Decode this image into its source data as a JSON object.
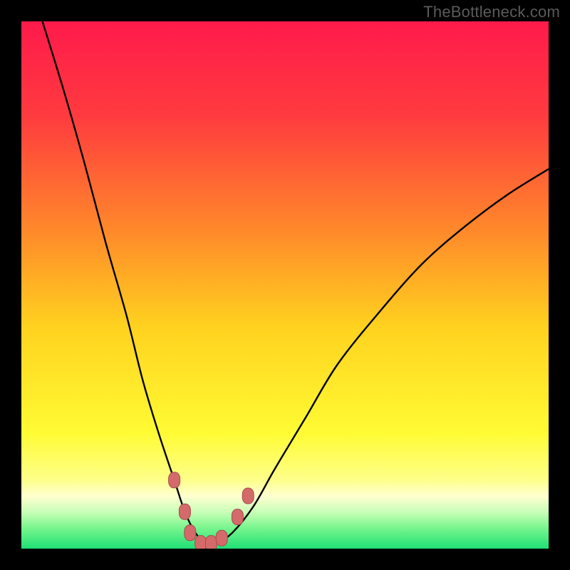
{
  "watermark": "TheBottleneck.com",
  "colors": {
    "bg_black": "#000000",
    "gradient_stops": [
      {
        "offset": 0.0,
        "color": "#ff1a4b"
      },
      {
        "offset": 0.18,
        "color": "#ff3b3f"
      },
      {
        "offset": 0.4,
        "color": "#ff8a2a"
      },
      {
        "offset": 0.58,
        "color": "#ffd21f"
      },
      {
        "offset": 0.78,
        "color": "#fffb33"
      },
      {
        "offset": 0.87,
        "color": "#fdff8a"
      },
      {
        "offset": 0.9,
        "color": "#ffffd0"
      },
      {
        "offset": 0.93,
        "color": "#caffb8"
      },
      {
        "offset": 0.96,
        "color": "#7af58e"
      },
      {
        "offset": 1.0,
        "color": "#1fe076"
      }
    ],
    "curve": "#000000",
    "marker_fill": "#d46a6a",
    "marker_stroke": "#a34c4c"
  },
  "chart_data": {
    "type": "line",
    "title": "",
    "xlabel": "",
    "ylabel": "",
    "xlim": [
      0,
      100
    ],
    "ylim": [
      0,
      100
    ],
    "series": [
      {
        "name": "bottleneck-curve",
        "x": [
          4,
          8,
          12,
          16,
          20,
          23,
          26,
          29,
          31,
          33,
          35,
          37,
          40,
          44,
          48,
          54,
          60,
          68,
          76,
          84,
          92,
          100
        ],
        "y": [
          100,
          87,
          73,
          58,
          44,
          32,
          22,
          13,
          7,
          3,
          1,
          1,
          3,
          8,
          15,
          25,
          35,
          45,
          54,
          61,
          67,
          72
        ]
      }
    ],
    "markers": {
      "name": "highlight-cluster",
      "points": [
        {
          "x": 29,
          "y": 13
        },
        {
          "x": 31,
          "y": 7
        },
        {
          "x": 32,
          "y": 3
        },
        {
          "x": 34,
          "y": 1
        },
        {
          "x": 36,
          "y": 1
        },
        {
          "x": 38,
          "y": 2
        },
        {
          "x": 41,
          "y": 6
        },
        {
          "x": 43,
          "y": 10
        }
      ]
    }
  }
}
